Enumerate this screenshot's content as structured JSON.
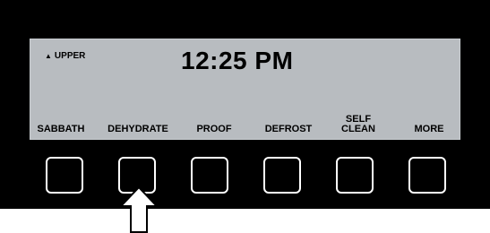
{
  "display": {
    "indicator": "UPPER",
    "indicator_icon": "up-triangle-icon",
    "time": "12:25 PM"
  },
  "softkeys": [
    {
      "label": "SABBATH"
    },
    {
      "label": "DEHYDRATE"
    },
    {
      "label": "PROOF"
    },
    {
      "label": "DEFROST"
    },
    {
      "label": "SELF\nCLEAN"
    },
    {
      "label": "MORE"
    }
  ],
  "pointer": {
    "icon": "up-arrow-icon",
    "target_index": 1
  },
  "colors": {
    "panel": "#000000",
    "lcd": "#b8bcc0",
    "button_border": "#ffffff"
  }
}
